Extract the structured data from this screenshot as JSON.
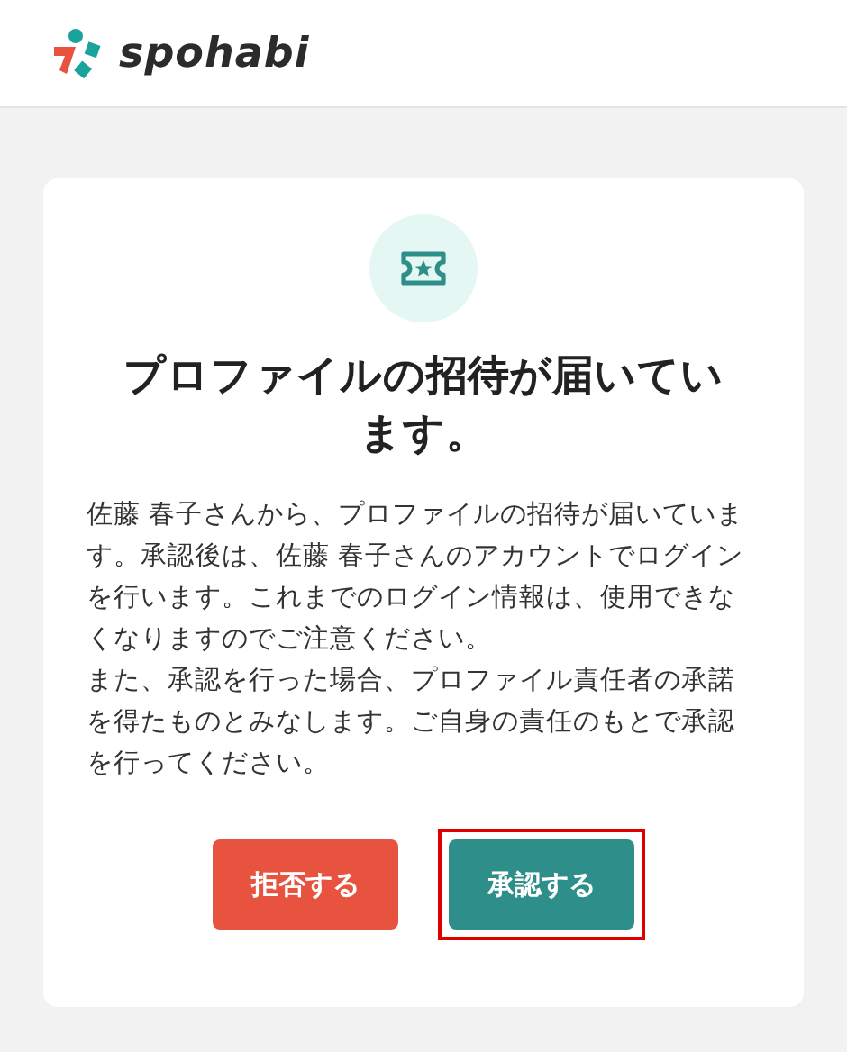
{
  "header": {
    "logo_text": "spohabi"
  },
  "card": {
    "title": "プロファイルの招待が届いています。",
    "paragraphs": [
      "佐藤 春子さんから、プロファイルの招待が届いています。承認後は、佐藤 春子さんのアカウントでログインを行います。これまでのログイン情報は、使用できなくなりますのでご注意ください。",
      "また、承認を行った場合、プロファイル責任者の承諾を得たものとみなします。ご自身の責任のもとで承認を行ってください。"
    ],
    "buttons": [
      {
        "label": "拒否する",
        "kind": "reject",
        "highlighted": false
      },
      {
        "label": "承認する",
        "kind": "approve",
        "highlighted": true
      }
    ]
  }
}
